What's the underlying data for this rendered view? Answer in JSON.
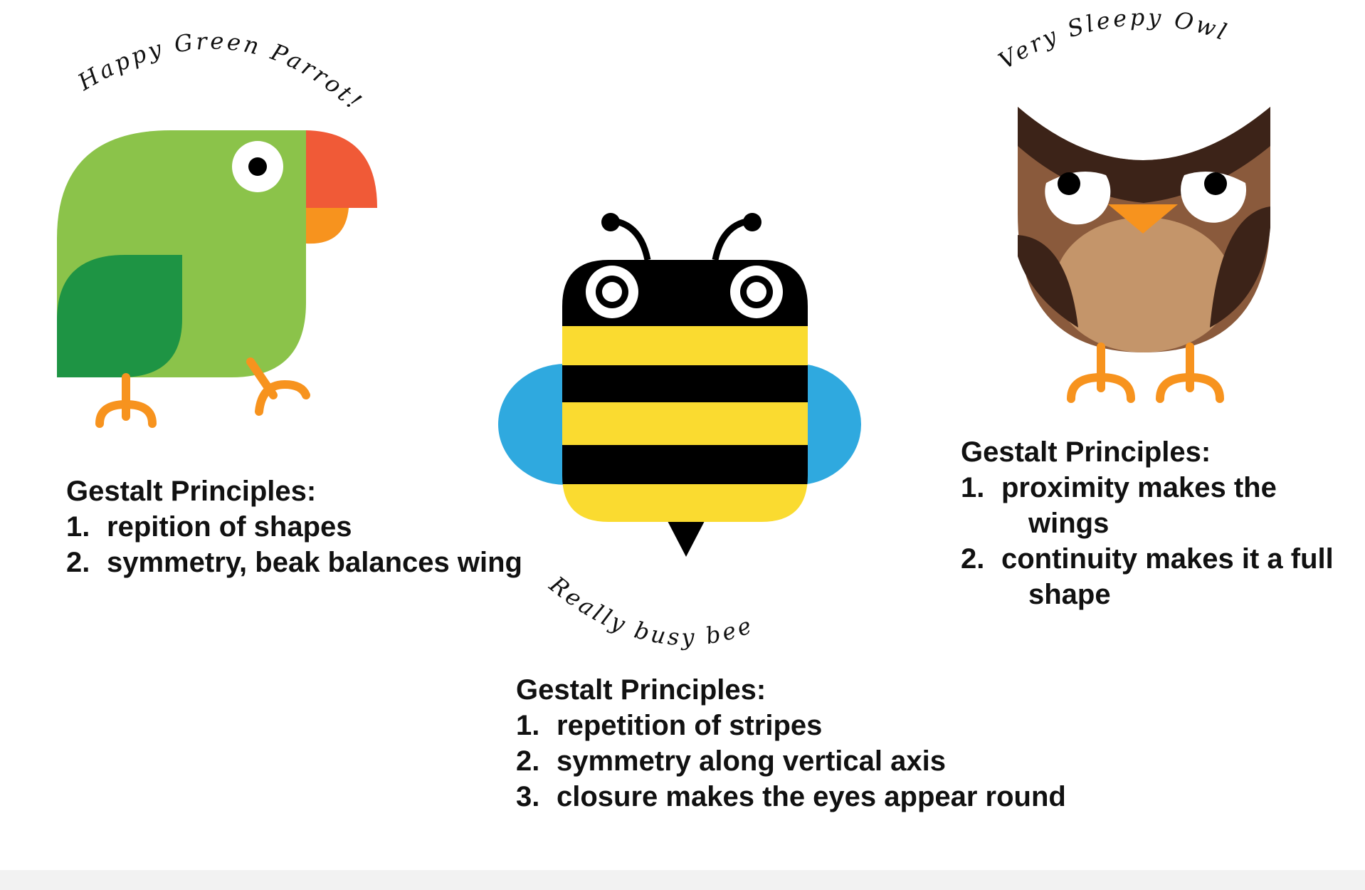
{
  "parrot": {
    "caption": "Happy Green Parrot!",
    "heading": "Gestalt Principles:",
    "items": [
      {
        "num": "1.",
        "text": "repition of shapes"
      },
      {
        "num": "2.",
        "text": "symmetry, beak balances wing"
      }
    ],
    "colors": {
      "body": "#8bc34a",
      "wing": "#1e9444",
      "beak_top": "#f05a37",
      "beak_bottom": "#f7931e",
      "feet": "#f7931e"
    }
  },
  "bee": {
    "caption": "Really busy bee",
    "heading": "Gestalt Principles:",
    "items": [
      {
        "num": "1.",
        "text": "repetition of stripes"
      },
      {
        "num": "2.",
        "text": "symmetry along vertical axis"
      },
      {
        "num": "3.",
        "text": "closure makes the eyes appear round"
      }
    ],
    "colors": {
      "stripe_dark": "#000000",
      "stripe_light": "#fadb30",
      "wings": "#2fa9df"
    }
  },
  "owl": {
    "caption": "Very Sleepy Owl",
    "heading": "Gestalt Principles:",
    "items": [
      {
        "num": "1.",
        "text": "proximity makes the wings"
      },
      {
        "num": "2.",
        "text": "continuity makes it a full shape"
      }
    ],
    "colors": {
      "body": "#8a5a3c",
      "dark": "#3c2318",
      "belly": "#c4956a",
      "beak": "#f7931e",
      "feet": "#f7931e"
    }
  }
}
